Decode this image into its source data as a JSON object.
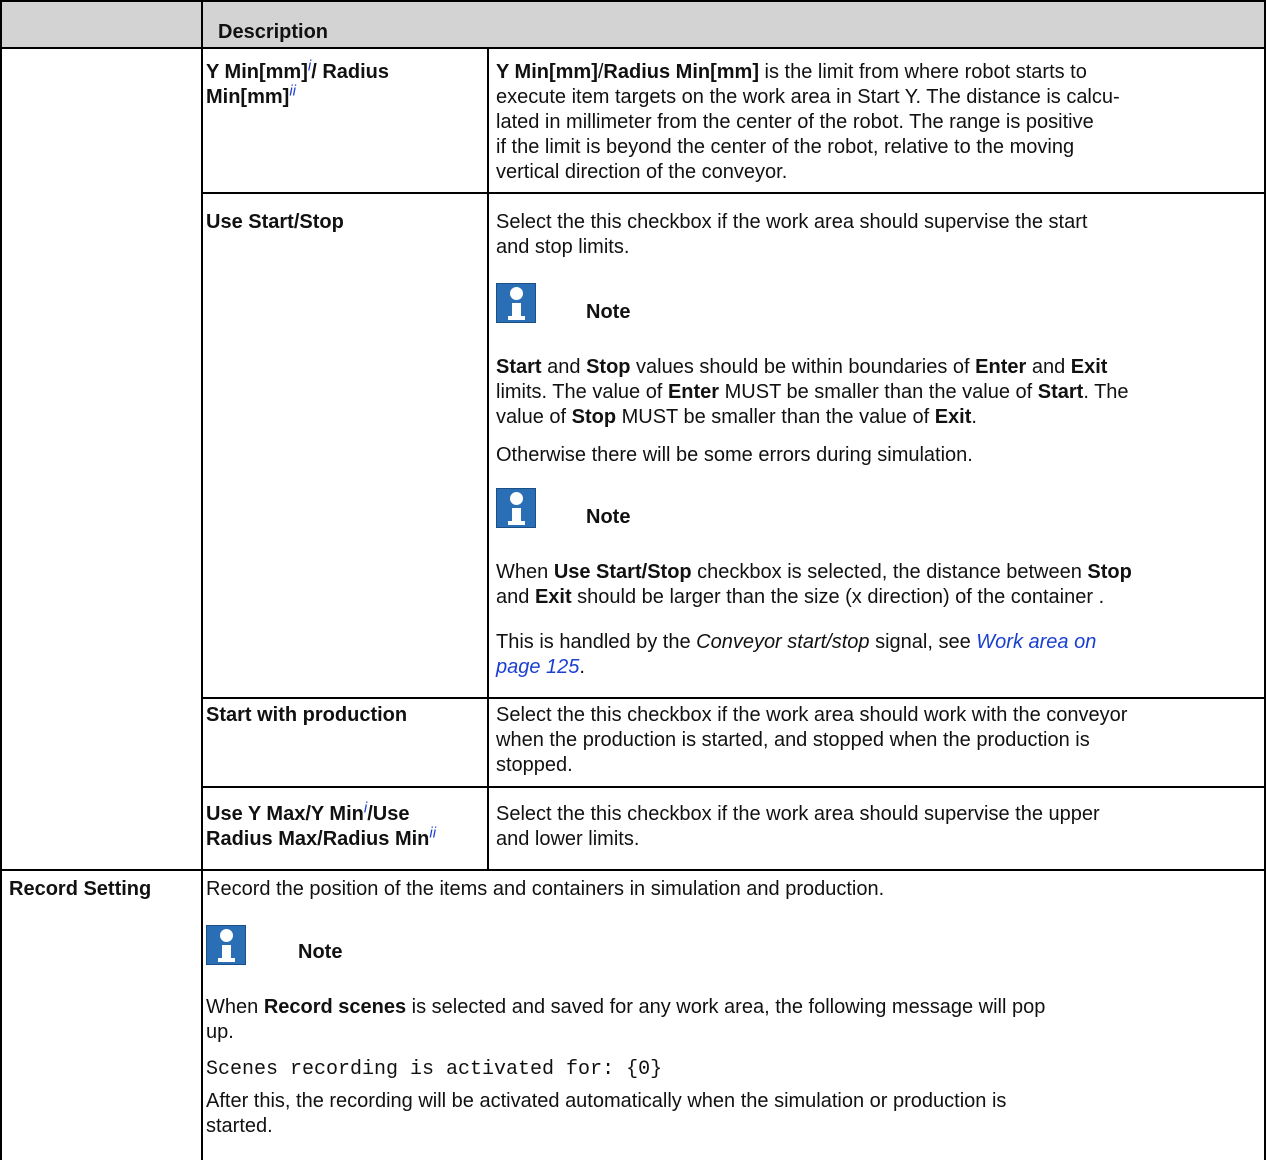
{
  "table": {
    "header": {
      "col1": "",
      "col2": "Description"
    },
    "rows": [
      {
        "name_parts": [
          "Y Min[mm]",
          "i",
          "/ Radius",
          "Min[mm]",
          "ii"
        ],
        "desc_lines": [
          [
            "Y Min[mm]",
            "/",
            "Radius Min[mm]",
            " is the limit from where robot starts to"
          ],
          "execute item targets on the work area in Start Y. The distance is calcu-",
          "lated in millimeter from the center of the robot. The range is positive",
          "if the limit is beyond the center of the robot, relative to the moving",
          "vertical direction of the conveyor."
        ]
      },
      {
        "name_parts": [
          "Use Start",
          "/",
          "Stop"
        ],
        "desc_lines": [
          "Select the this checkbox if the work area should supervise the start",
          "and stop limits."
        ],
        "note1": {
          "icon": "info-icon",
          "label": "Note",
          "lines": [
            [
              "Start",
              " and ",
              "Stop",
              " values should be within boundaries of ",
              "Enter",
              " and ",
              "Exit"
            ],
            [
              "limits. The value of ",
              "Enter",
              " MUST be smaller than the value of ",
              "Start",
              ". The"
            ],
            [
              "value of ",
              "Stop",
              " MUST be smaller than the value of ",
              "Exit",
              "."
            ],
            "Otherwise there will be some errors during simulation."
          ]
        },
        "note2": {
          "icon": "info-icon",
          "label": "Note",
          "lines": [
            [
              "When ",
              "Use Start",
              "/",
              "Stop",
              " checkbox is selected, the distance between ",
              "Stop"
            ],
            [
              "and ",
              "Exit",
              " should be larger than the size (x direction) of the container ."
            ],
            [
              "This is handled by the ",
              "Conveyor start/stop",
              " signal, see ",
              "Work area on"
            ],
            [
              "page 125",
              "."
            ]
          ]
        }
      },
      {
        "name": "Start with production",
        "desc_lines": [
          "Select the this checkbox if the work area should work with the conveyor",
          "when the production is started, and stopped when the production is",
          "stopped."
        ]
      },
      {
        "name_parts": [
          "Use Y Max",
          "/",
          "Y Min",
          "i",
          "/",
          "Use",
          "Radius Max",
          "/",
          "Radius Min",
          "ii"
        ],
        "desc_lines": [
          "Select the this checkbox if the work area should supervise the upper",
          "and lower limits."
        ]
      }
    ],
    "record": {
      "name": "Record Setting",
      "intro": "Record the position of the items and containers in simulation and production.",
      "note": {
        "icon": "info-icon",
        "label": "Note",
        "lines": [
          [
            "When ",
            "Record scenes",
            " is selected and saved for any work area, the following message will pop"
          ],
          "up."
        ]
      },
      "code": "Scenes recording is activated for: {0}",
      "after_lines": [
        "After this, the recording will be activated automatically when the simulation or production is",
        "started."
      ]
    }
  }
}
